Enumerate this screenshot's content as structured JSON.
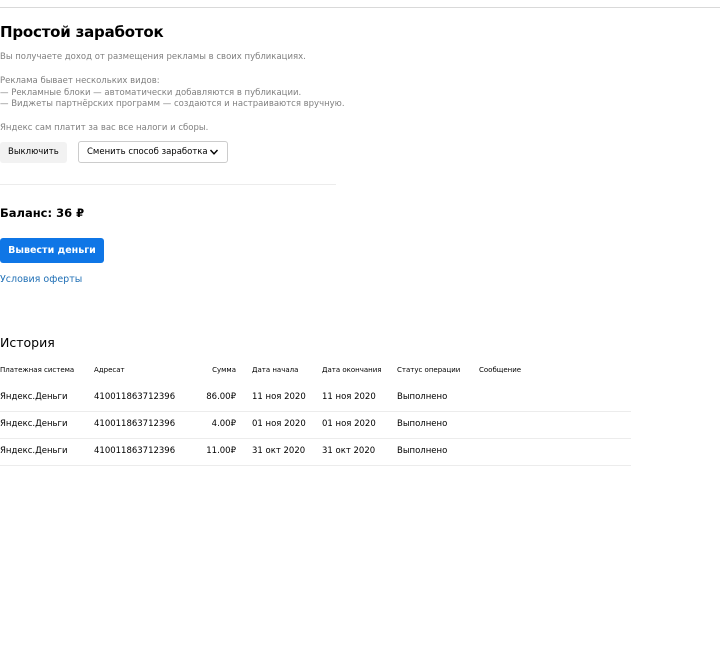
{
  "page": {
    "title": "Простой заработок",
    "intro": "Вы получаете доход от размещения рекламы в своих публикациях.",
    "ad_types_heading": "Реклама бывает нескольких видов:",
    "ad_type_1": "— Рекламные блоки — автоматически добавляются в публикации.",
    "ad_type_2": "— Виджеты партнёрских программ — создаются и настраиваются вручную.",
    "taxes_note": "Яндекс сам платит за вас все налоги и сборы."
  },
  "actions": {
    "disable_label": "Выключить",
    "change_method_label": "Сменить способ заработка"
  },
  "balance": {
    "text": "Баланс: 36 ₽",
    "withdraw_label": "Вывести деньги",
    "offer_terms_link": "Условия оферты"
  },
  "history": {
    "title": "История",
    "columns": {
      "system": "Платежная система",
      "recipient": "Адресат",
      "amount": "Сумма",
      "start_date": "Дата начала",
      "end_date": "Дата окончания",
      "status": "Статус операции",
      "message": "Сообщение"
    },
    "rows": [
      {
        "system": "Яндекс.Деньги",
        "recipient": "410011863712396",
        "amount": "86.00₽",
        "start_date": "11 ноя 2020",
        "end_date": "11 ноя 2020",
        "status": "Выполнено",
        "message": ""
      },
      {
        "system": "Яндекс.Деньги",
        "recipient": "410011863712396",
        "amount": "4.00₽",
        "start_date": "01 ноя 2020",
        "end_date": "01 ноя 2020",
        "status": "Выполнено",
        "message": ""
      },
      {
        "system": "Яндекс.Деньги",
        "recipient": "410011863712396",
        "amount": "11.00₽",
        "start_date": "31 окт 2020",
        "end_date": "31 окт 2020",
        "status": "Выполнено",
        "message": ""
      }
    ]
  },
  "colors": {
    "primary_button": "#0f76e6",
    "link": "#1f6fb5",
    "muted_text": "#7f7f7f"
  }
}
